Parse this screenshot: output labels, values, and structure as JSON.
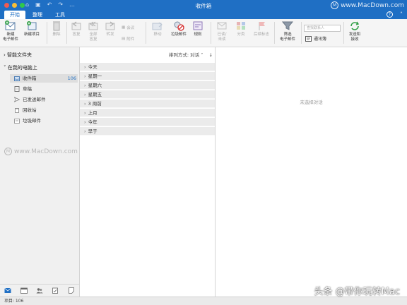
{
  "window": {
    "title": "收件箱",
    "watermark_top": "www.MacDown.com",
    "watermark_mid": "www.MacDown.com",
    "watermark_bottom": "头条 @带你玩转Mac",
    "watermark_logo": "M"
  },
  "tabs": [
    {
      "label": "开始",
      "active": true
    },
    {
      "label": "整理",
      "active": false
    },
    {
      "label": "工具",
      "active": false
    }
  ],
  "ribbon": {
    "new_email_line1": "新建",
    "new_email_line2": "电子邮件",
    "new_item": "新建项目",
    "delete": "删除",
    "reply": "答复",
    "reply_all_line1": "全部",
    "reply_all_line2": "答复",
    "forward": "转发",
    "meeting": "会议",
    "attachment": "附件",
    "move": "移动",
    "junk": "垃圾邮件",
    "rules": "规则",
    "read_unread_line1": "已读/",
    "read_unread_line2": "未读",
    "categorize": "分类",
    "follow_up": "后续标志",
    "filter_line1": "筛选",
    "filter_line2": "电子邮件",
    "search_people_placeholder": "查找联系人",
    "address_book": "通讯簿",
    "send_receive_line1": "发送和",
    "send_receive_line2": "接收"
  },
  "sidebar": {
    "smart_folders": "智能文件夹",
    "on_my_computer": "在我的电脑上",
    "folders": [
      {
        "label": "收件箱",
        "count": "106",
        "icon": "inbox-icon"
      },
      {
        "label": "草稿",
        "count": "",
        "icon": "drafts-icon"
      },
      {
        "label": "已发送邮件",
        "count": "",
        "icon": "sent-icon"
      },
      {
        "label": "回收站",
        "count": "",
        "icon": "trash-icon"
      },
      {
        "label": "垃圾邮件",
        "count": "",
        "icon": "junk-icon"
      }
    ]
  },
  "message_list": {
    "sort_label": "排列方式: 对话",
    "groups": [
      "今天",
      "星期一",
      "星期六",
      "星期五",
      "3 周前",
      "上月",
      "今年",
      "早于"
    ]
  },
  "reading_pane": {
    "empty_text": "未选择对话"
  },
  "status": {
    "items_text": "项目: 106"
  },
  "colors": {
    "accent": "#1f6fc4",
    "count": "#1f6fc4"
  }
}
